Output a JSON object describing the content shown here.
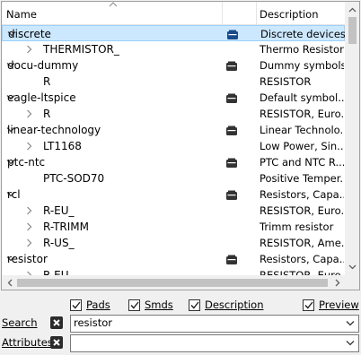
{
  "header": {
    "name_col": "Name",
    "desc_col": "Description"
  },
  "rows": [
    {
      "level": 0,
      "expanded": true,
      "selected": true,
      "name": "discrete",
      "icon": "library-icon",
      "desc": "Discrete devices..."
    },
    {
      "level": 1,
      "expanded": false,
      "name": "THERMISTOR_",
      "icon": "",
      "desc": "Thermo Resistor"
    },
    {
      "level": 0,
      "expanded": true,
      "name": "docu-dummy",
      "icon": "library-icon",
      "desc": "Dummy symbols"
    },
    {
      "level": 1,
      "leaf": true,
      "name": "R",
      "icon": "",
      "desc": "RESISTOR"
    },
    {
      "level": 0,
      "expanded": true,
      "name": "eagle-ltspice",
      "icon": "library-icon",
      "desc": "Default symbol..."
    },
    {
      "level": 1,
      "expanded": false,
      "name": "R",
      "icon": "",
      "desc": "RESISTOR, Euro..."
    },
    {
      "level": 0,
      "expanded": true,
      "name": "linear-technology",
      "icon": "library-icon",
      "desc": "Linear Technolo..."
    },
    {
      "level": 1,
      "expanded": false,
      "name": "LT1168",
      "icon": "",
      "desc": "Low Power, Sin..."
    },
    {
      "level": 0,
      "expanded": true,
      "name": "ptc-ntc",
      "icon": "library-icon",
      "desc": "PTC and NTC R..."
    },
    {
      "level": 1,
      "leaf": true,
      "name": "PTC-SOD70",
      "icon": "",
      "desc": "Positive Temper..."
    },
    {
      "level": 0,
      "expanded": true,
      "name": "rcl",
      "icon": "library-icon",
      "desc": "Resistors, Capa..."
    },
    {
      "level": 1,
      "expanded": false,
      "name": "R-EU_",
      "icon": "",
      "desc": "RESISTOR, Euro..."
    },
    {
      "level": 1,
      "expanded": false,
      "name": "R-TRIMM",
      "icon": "",
      "desc": "Trimm resistor"
    },
    {
      "level": 1,
      "expanded": false,
      "name": "R-US_",
      "icon": "",
      "desc": "RESISTOR, Ame..."
    },
    {
      "level": 0,
      "expanded": true,
      "name": "resistor",
      "icon": "library-icon",
      "desc": "Resistors, Capa..."
    },
    {
      "level": 1,
      "expanded": false,
      "name": "R-EU",
      "icon": "",
      "desc": "RESISTOR, Euro..."
    }
  ],
  "options": {
    "pads": {
      "label": "Pads",
      "checked": true
    },
    "smds": {
      "label": "Smds",
      "checked": true
    },
    "description": {
      "label": "Description",
      "checked": true
    },
    "preview": {
      "label": "Preview",
      "checked": true
    }
  },
  "search": {
    "label": "Search",
    "value": "resistor"
  },
  "attributes": {
    "label": "Attributes",
    "value": ""
  },
  "colors": {
    "selection": "#cce8ff",
    "selection_border": "#99d1ff",
    "background": "#f0f0f0"
  }
}
